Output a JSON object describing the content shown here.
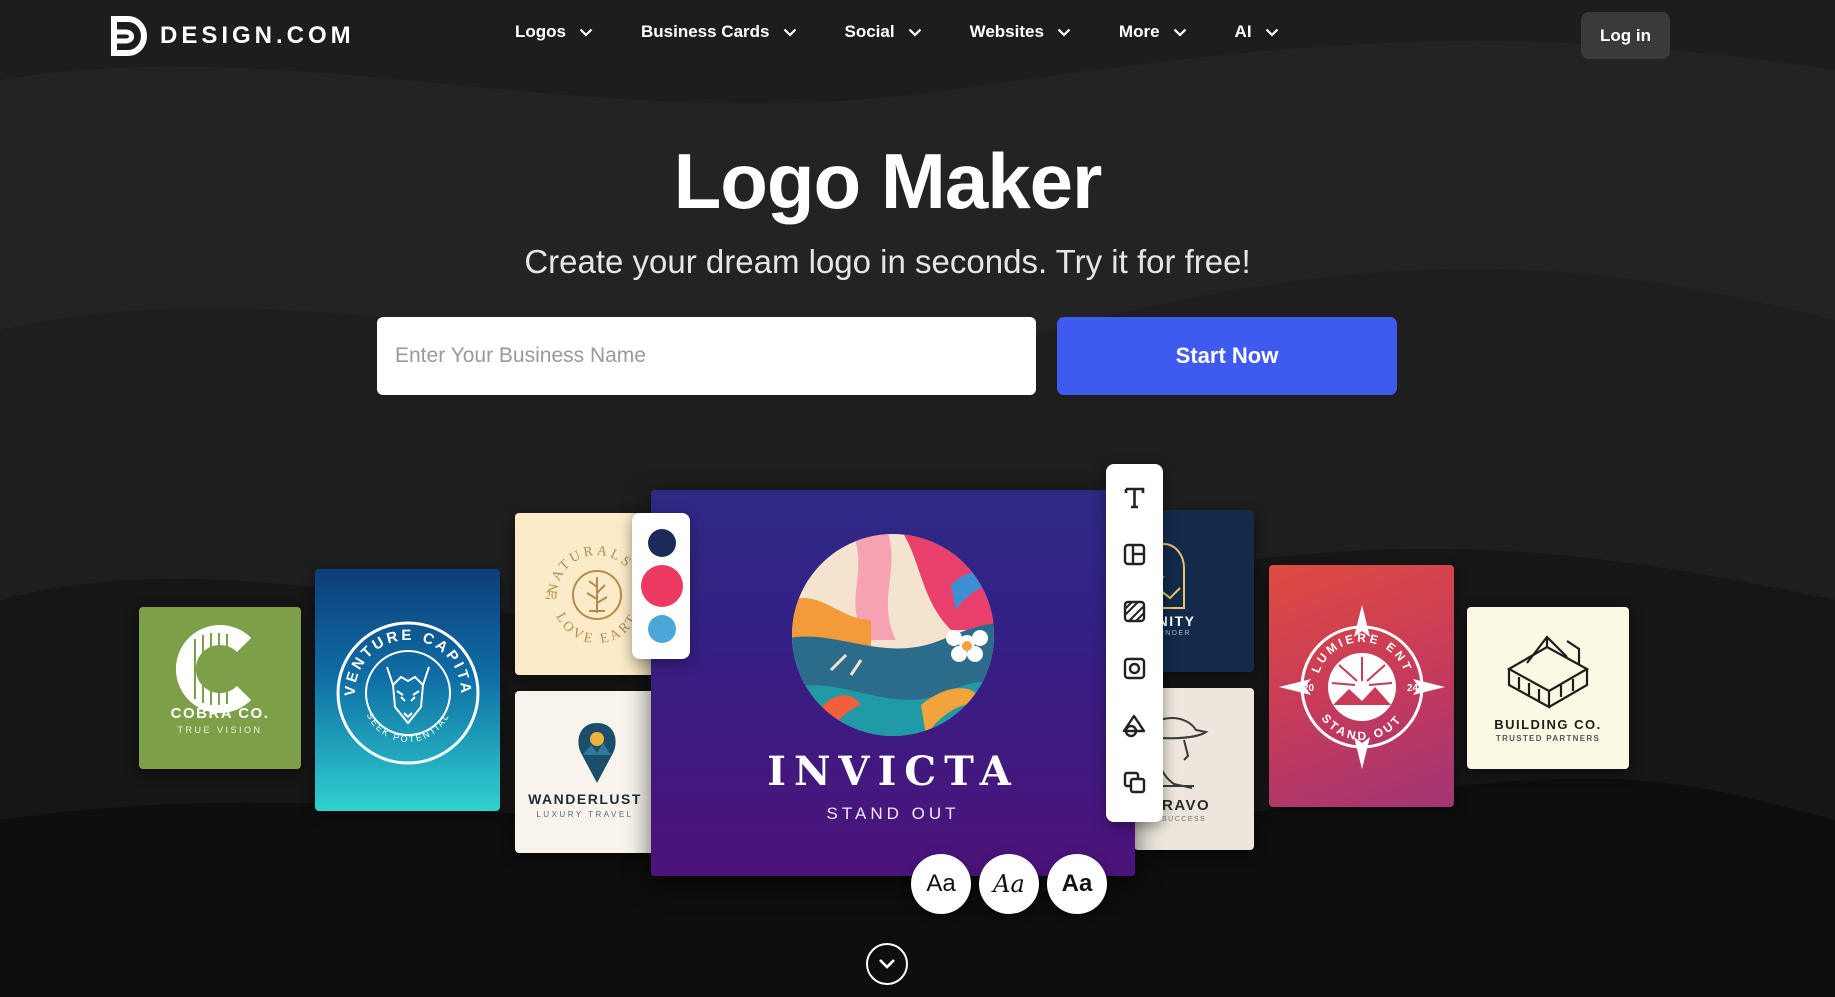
{
  "brand": {
    "name": "DESIGN.COM"
  },
  "nav": {
    "links": [
      {
        "label": "Logos"
      },
      {
        "label": "Business Cards"
      },
      {
        "label": "Social"
      },
      {
        "label": "Websites"
      },
      {
        "label": "More"
      },
      {
        "label": "AI"
      }
    ],
    "login_label": "Log in"
  },
  "hero": {
    "title": "Logo Maker",
    "subtitle": "Create your dream logo in seconds. Try it for free!",
    "input_placeholder": "Enter Your Business Name",
    "input_value": "",
    "cta_label": "Start Now"
  },
  "logo_cards": {
    "cobra": {
      "name": "COBRA CO.",
      "tagline": "TRUE VISION"
    },
    "venture": {
      "arc_top": "VENTURE CAPITA",
      "arc_bottom": "SEEK POTENTIAL"
    },
    "naturals": {
      "arc_top": "NATURALS IN",
      "arc_bottom": "LOVE EART",
      "year": "20"
    },
    "wanderlust": {
      "name": "WANDERLUST",
      "tagline": "LUXURY TRAVEL"
    },
    "eternity": {
      "name": "RNITY",
      "tagline": "FOUNDER"
    },
    "bravo": {
      "name": "RAVO",
      "tagline": "SUCCESS"
    },
    "lumiere": {
      "arc_top": "LUMIERE ENT",
      "arc_bottom": "STAND OUT",
      "year_left": "20",
      "year_right": "24"
    },
    "building": {
      "name": "BUILDING CO.",
      "tagline": "TRUSTED PARTNERS"
    },
    "featured": {
      "name": "INVICTA",
      "tagline": "STAND OUT"
    }
  },
  "palette": {
    "colors": [
      "#1b2a59",
      "#ed3a62",
      "#4aa7d8"
    ]
  },
  "toolbar": {
    "tools": [
      "text-icon",
      "layout-icon",
      "pattern-icon",
      "frame-icon",
      "shapes-icon",
      "copy-icon"
    ]
  },
  "font_options": [
    {
      "label": "Aa",
      "style": "regular"
    },
    {
      "label": "Aa",
      "style": "italic-serif"
    },
    {
      "label": "Aa",
      "style": "bold"
    }
  ],
  "colors": {
    "accent": "#3f5aef",
    "background": "#1c1c1c",
    "login_bg": "#3a3a3a"
  }
}
